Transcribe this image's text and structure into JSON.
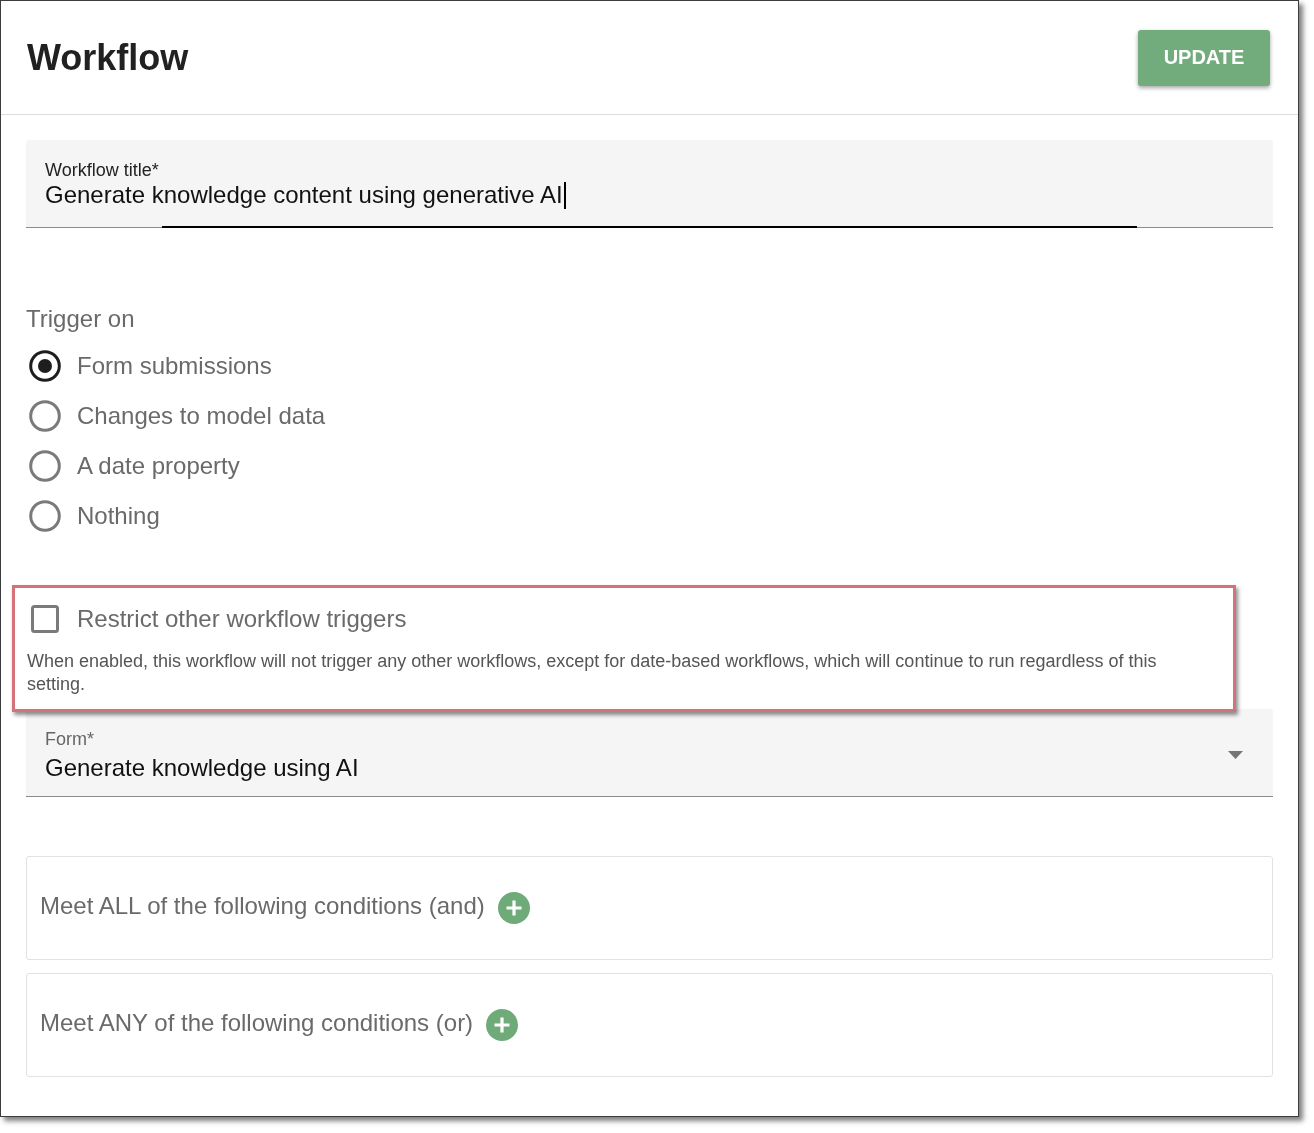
{
  "header": {
    "title": "Workflow",
    "button": "UPDATE"
  },
  "title_field": {
    "label": "Workflow title*",
    "value": "Generate knowledge content using generative AI",
    "focused": true
  },
  "trigger": {
    "label": "Trigger on",
    "options": [
      {
        "label": "Form submissions",
        "selected": true
      },
      {
        "label": "Changes to model data",
        "selected": false
      },
      {
        "label": "A date property",
        "selected": false
      },
      {
        "label": "Nothing",
        "selected": false
      }
    ]
  },
  "restrict": {
    "label": "Restrict other workflow triggers",
    "checked": false,
    "highlighted": true,
    "description": "When enabled, this workflow will not trigger any other workflows, except for date-based workflows, which will continue to run regardless of this setting."
  },
  "form_field": {
    "label": "Form*",
    "value": "Generate knowledge using AI"
  },
  "condition_groups": [
    {
      "label": "Meet ALL of the following conditions (and)"
    },
    {
      "label": "Meet ANY of the following conditions (or)"
    }
  ]
}
